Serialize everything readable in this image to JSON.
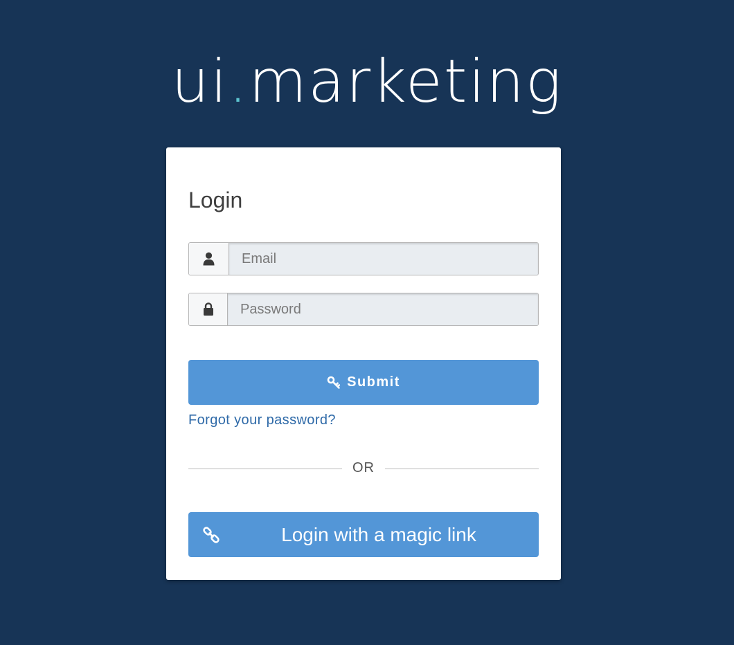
{
  "logo": {
    "part1": "ui",
    "dot": ".",
    "part2": "marketing"
  },
  "login": {
    "title": "Login",
    "email_placeholder": "Email",
    "password_placeholder": "Password",
    "submit_label": "Submit",
    "forgot_label": "Forgot your password?",
    "divider_label": "OR",
    "magic_link_label": "Login with a magic link"
  },
  "icons": {
    "email": "user-icon",
    "password": "lock-icon",
    "submit": "key-icon",
    "magic_link": "link-icon"
  },
  "colors": {
    "background": "#173456",
    "primary_button": "#5396d7",
    "link": "#2f6aa8",
    "logo_dot": "#5cc3cf"
  }
}
